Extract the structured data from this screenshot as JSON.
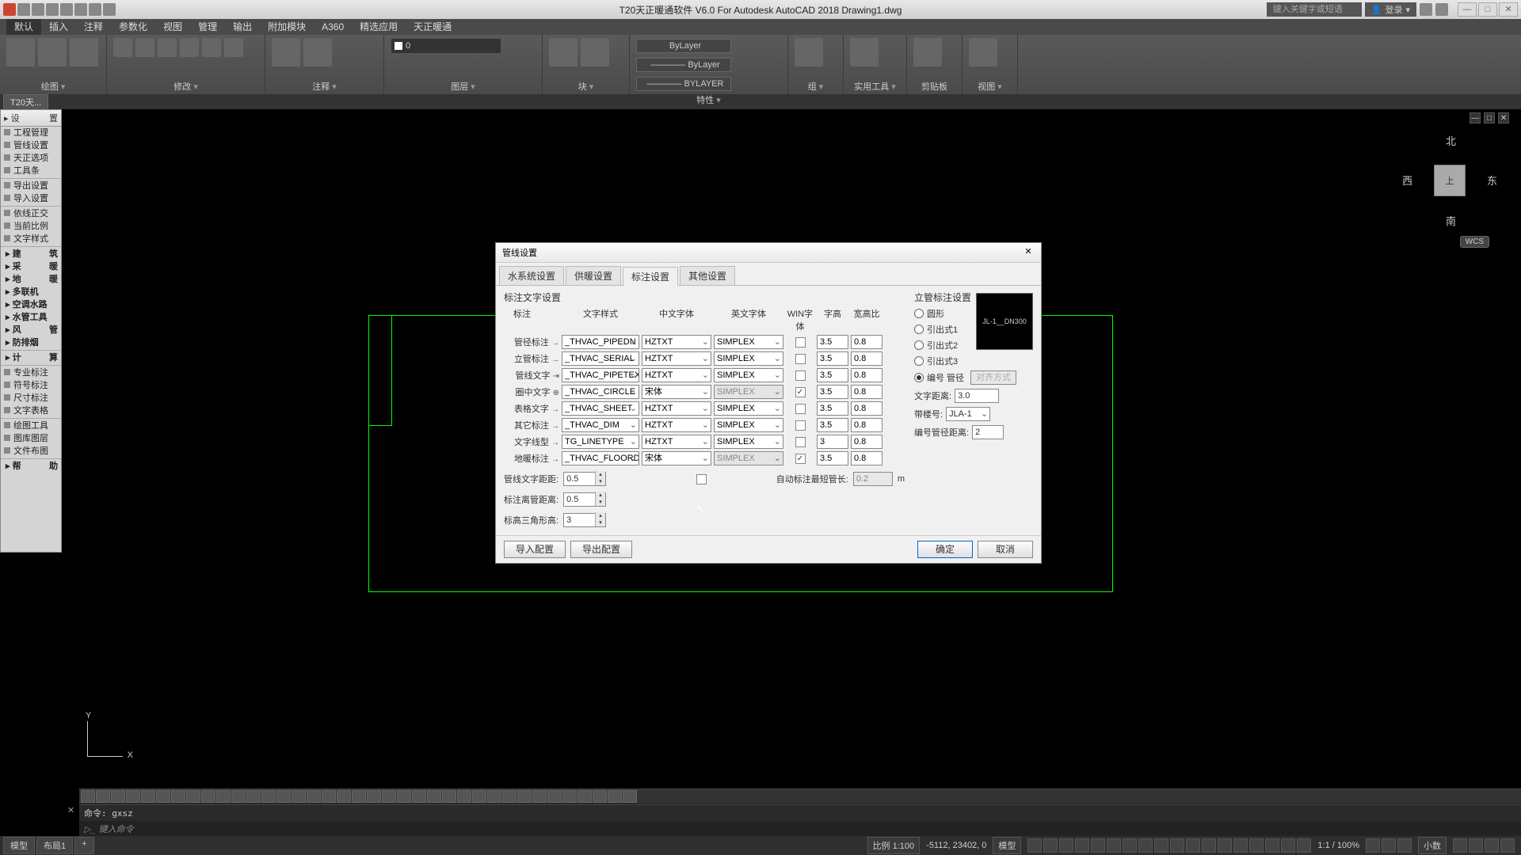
{
  "title": "T20天正暖通软件 V6.0 For Autodesk AutoCAD 2018  Drawing1.dwg",
  "search_placeholder": "键入关键字或短语",
  "login": "登录",
  "window_buttons": {
    "min": "—",
    "max": "□",
    "close": "✕"
  },
  "menu": [
    "默认",
    "插入",
    "注释",
    "参数化",
    "视图",
    "管理",
    "输出",
    "附加模块",
    "A360",
    "精选应用",
    "天正暖通"
  ],
  "ribbon": {
    "panels": [
      "绘图",
      "修改",
      "注释",
      "图层",
      "块",
      "特性",
      "组",
      "实用工具",
      "剪贴板",
      "视图"
    ],
    "layer_value": "0",
    "prop_lines": [
      "ByLayer",
      "———— ByLayer",
      "———— BYLAYER"
    ]
  },
  "tab_strip": "T20天...",
  "palette": {
    "header_left": "设",
    "header_right": "置",
    "items": [
      "工程管理",
      "管线设置",
      "天正选项",
      "工具条"
    ],
    "items2": [
      "导出设置",
      "导入设置"
    ],
    "items3": [
      "依线正交",
      "当前比例",
      "文字样式"
    ],
    "groups": [
      {
        "l": "建",
        "r": "筑"
      },
      {
        "l": "采",
        "r": "暖"
      },
      {
        "l": "地",
        "r": "暖"
      },
      {
        "l": "多联机",
        "r": ""
      },
      {
        "l": "空调水路",
        "r": ""
      },
      {
        "l": "水管工具",
        "r": ""
      },
      {
        "l": "风",
        "r": "管"
      },
      {
        "l": "防排烟",
        "r": ""
      }
    ],
    "groups2": [
      {
        "l": "计",
        "r": "算"
      }
    ],
    "groups3": [
      "专业标注",
      "符号标注",
      "尺寸标注",
      "文字表格"
    ],
    "groups4": [
      "绘图工具",
      "图库图层",
      "文件布图"
    ],
    "groups5": [
      {
        "l": "帮",
        "r": "助"
      }
    ]
  },
  "compass": {
    "n": "北",
    "s": "南",
    "e": "东",
    "w": "西",
    "top": "上",
    "wcs": "WCS"
  },
  "view_ctl": [
    "—",
    "□",
    "✕"
  ],
  "dialog": {
    "title": "管线设置",
    "tabs": [
      "水系统设置",
      "供暖设置",
      "标注设置",
      "其他设置"
    ],
    "active_tab": 2,
    "section": "标注文字设置",
    "headers": {
      "label": "标注",
      "style": "文字样式",
      "cn": "中文字体",
      "en": "英文字体",
      "win": "WIN字体",
      "h": "字高",
      "ratio": "宽高比"
    },
    "rows": [
      {
        "label": "管径标注",
        "arrow": "→",
        "style": "_THVAC_PIPEDN",
        "cn": "HZTXT",
        "en": "SIMPLEX",
        "win": false,
        "h": "3.5",
        "r": "0.8"
      },
      {
        "label": "立管标注",
        "arrow": "→",
        "style": "_THVAC_SERIAL",
        "cn": "HZTXT",
        "en": "SIMPLEX",
        "win": false,
        "h": "3.5",
        "r": "0.8"
      },
      {
        "label": "管线文字",
        "arrow": "⇥",
        "style": "_THVAC_PIPETEX",
        "cn": "HZTXT",
        "en": "SIMPLEX",
        "win": false,
        "h": "3.5",
        "r": "0.8"
      },
      {
        "label": "圈中文字",
        "arrow": "⊕",
        "style": "_THVAC_CIRCLE",
        "cn": "宋体",
        "en": "SIMPLEX",
        "win": true,
        "h": "3.5",
        "r": "0.8",
        "en_dis": true
      },
      {
        "label": "表格文字",
        "arrow": "→",
        "style": "_THVAC_SHEET",
        "cn": "HZTXT",
        "en": "SIMPLEX",
        "win": false,
        "h": "3.5",
        "r": "0.8"
      },
      {
        "label": "其它标注",
        "arrow": "→",
        "style": "_THVAC_DIM",
        "cn": "HZTXT",
        "en": "SIMPLEX",
        "win": false,
        "h": "3.5",
        "r": "0.8"
      },
      {
        "label": "文字线型",
        "arrow": "→",
        "style": "TG_LINETYPE",
        "cn": "HZTXT",
        "en": "SIMPLEX",
        "win": false,
        "h": "3",
        "r": "0.8"
      },
      {
        "label": "地暖标注",
        "arrow": "→",
        "style": "_THVAC_FLOORDI",
        "cn": "宋体",
        "en": "SIMPLEX",
        "win": true,
        "h": "3.5",
        "r": "0.8",
        "en_dis": true
      }
    ],
    "lower": {
      "pipe_text_dist_label": "管线文字距距:",
      "pipe_text_dist": "0.5",
      "auto_label": "自动标注最短管长:",
      "auto_val": "0.2",
      "auto_unit": "m",
      "away_pipe_label": "标注离管距离:",
      "away_pipe": "0.5",
      "tri_h_label": "标高三角形高:",
      "tri_h": "3"
    },
    "right": {
      "title": "立管标注设置",
      "radios": [
        "圆形",
        "引出式1",
        "引出式2",
        "引出式3",
        "编号 管径"
      ],
      "selected": 4,
      "align_btn": "对齐方式",
      "preview": "JL-1__DN300",
      "text_dist_label": "文字距离:",
      "text_dist": "3.0",
      "with_floor_label": "带楼号:",
      "with_floor": "JLA-1",
      "num_pipe_dist_label": "编号管径距离:",
      "num_pipe_dist": "2"
    },
    "footer": {
      "import": "导入配置",
      "export": "导出配置",
      "ok": "确定",
      "cancel": "取消"
    }
  },
  "cmd": {
    "history": "命令: gxsz",
    "prompt": "键入命令"
  },
  "status": {
    "tabs": [
      "模型",
      "布局1"
    ],
    "plus": "+",
    "scale": "比例 1:100",
    "coords": "-5112, 23402, 0",
    "space": "模型",
    "zoom": "1:1 / 100%",
    "dec": "小数"
  }
}
